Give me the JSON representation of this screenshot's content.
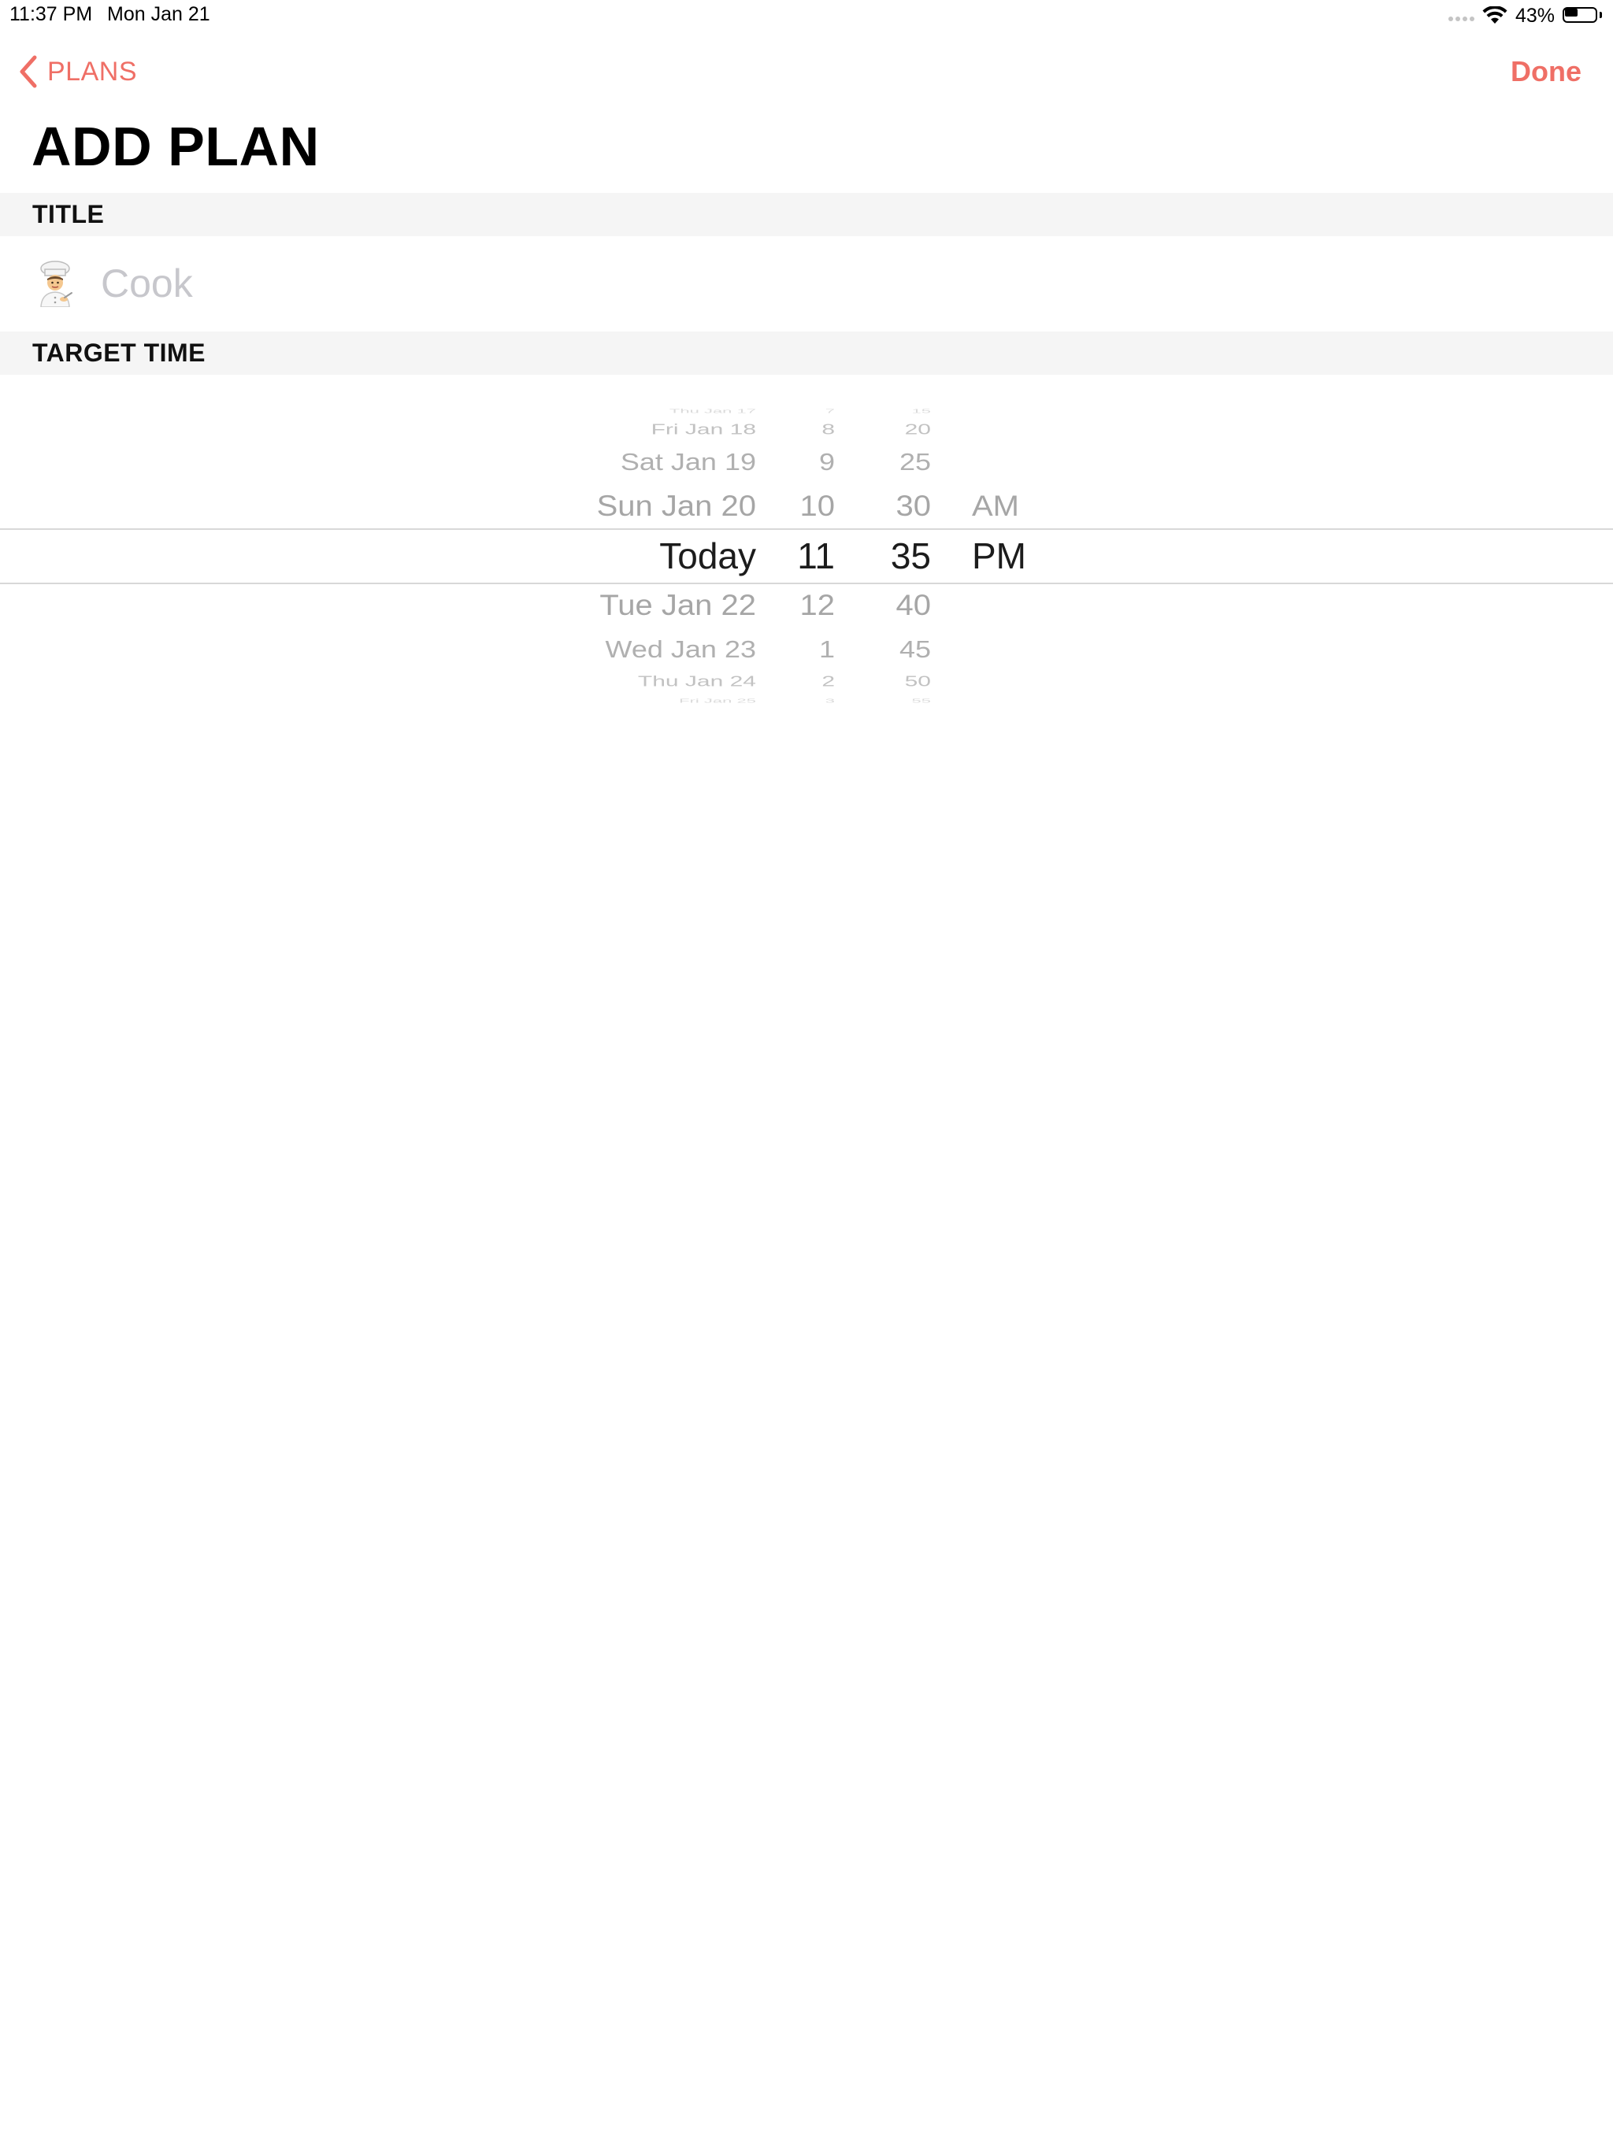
{
  "status_bar": {
    "time": "11:37 PM",
    "date": "Mon Jan 21",
    "battery_percent": "43%",
    "battery_level": 0.43,
    "icons": [
      "signal-dots-icon",
      "wifi-icon",
      "battery-icon"
    ]
  },
  "nav": {
    "back_label": "PLANS",
    "done_label": "Done",
    "accent_color": "#ef6f66"
  },
  "page": {
    "title": "ADD PLAN"
  },
  "sections": {
    "title_header": "TITLE",
    "target_time_header": "TARGET TIME"
  },
  "title_field": {
    "icon": "chef-icon",
    "value": "",
    "placeholder": "Cook"
  },
  "picker": {
    "rows": [
      {
        "date": "Thu Jan 17",
        "hour": "7",
        "minute": "15",
        "ampm": ""
      },
      {
        "date": "Fri Jan 18",
        "hour": "8",
        "minute": "20",
        "ampm": ""
      },
      {
        "date": "Sat Jan 19",
        "hour": "9",
        "minute": "25",
        "ampm": ""
      },
      {
        "date": "Sun Jan 20",
        "hour": "10",
        "minute": "30",
        "ampm": "AM"
      },
      {
        "date": "Today",
        "hour": "11",
        "minute": "35",
        "ampm": "PM"
      },
      {
        "date": "Tue Jan 22",
        "hour": "12",
        "minute": "40",
        "ampm": ""
      },
      {
        "date": "Wed Jan 23",
        "hour": "1",
        "minute": "45",
        "ampm": ""
      },
      {
        "date": "Thu Jan 24",
        "hour": "2",
        "minute": "50",
        "ampm": ""
      },
      {
        "date": "Fri Jan 25",
        "hour": "3",
        "minute": "55",
        "ampm": ""
      }
    ],
    "selected_index": 4
  }
}
